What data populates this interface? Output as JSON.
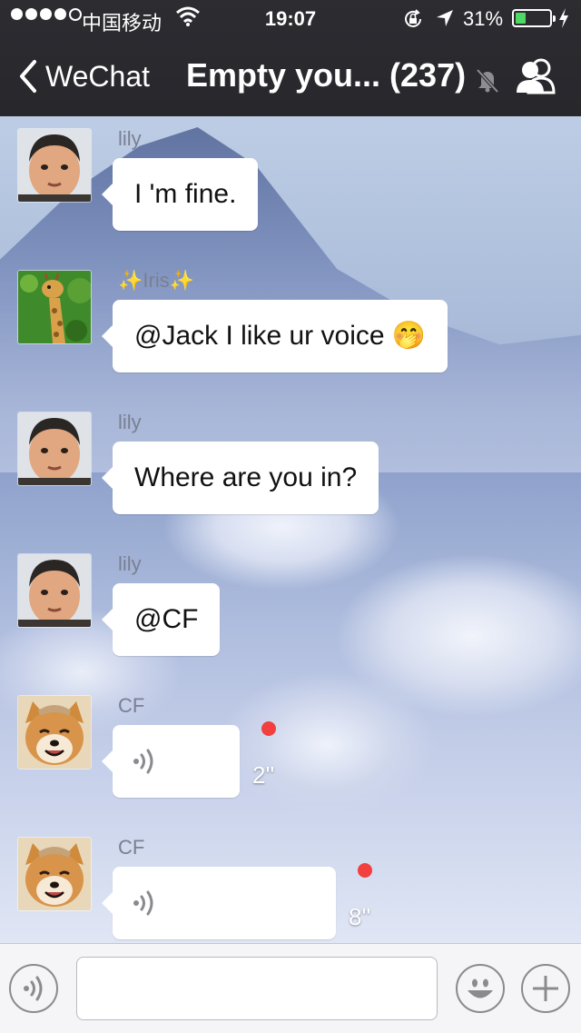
{
  "status_bar": {
    "carrier": "中国移动",
    "time": "19:07",
    "battery_percent": "31%",
    "battery_level": 0.31,
    "battery_color": "#4cd964"
  },
  "nav": {
    "back_label": "WeChat",
    "title": "Empty you... (237)",
    "mute_icon": "mute-bell-icon",
    "group_icon": "group-members-icon"
  },
  "messages": [
    {
      "sender": "lily",
      "text": "I 'm fine.",
      "avatar": "boy-avatar"
    },
    {
      "sender": "✨Iris✨",
      "text": "@Jack I like ur voice 🤭",
      "avatar": "giraffe-avatar"
    },
    {
      "sender": "lily",
      "text": "Where are you in?",
      "avatar": "boy-avatar"
    },
    {
      "sender": "lily",
      "text": "@CF",
      "avatar": "boy-avatar"
    },
    {
      "sender": "CF",
      "type": "voice",
      "duration": "2''",
      "unread": true,
      "avatar": "shiba-dog-avatar"
    },
    {
      "sender": "CF",
      "type": "voice",
      "duration": "8''",
      "unread": true,
      "avatar": "shiba-dog-avatar"
    }
  ],
  "input_bar": {
    "voice_toggle_icon": "voice-mode-icon",
    "text_placeholder": "",
    "emoji_icon": "emoji-icon",
    "more_icon": "plus-icon"
  },
  "colors": {
    "nav_background": "#2a2a2f",
    "unread_dot": "#f23f3f"
  }
}
